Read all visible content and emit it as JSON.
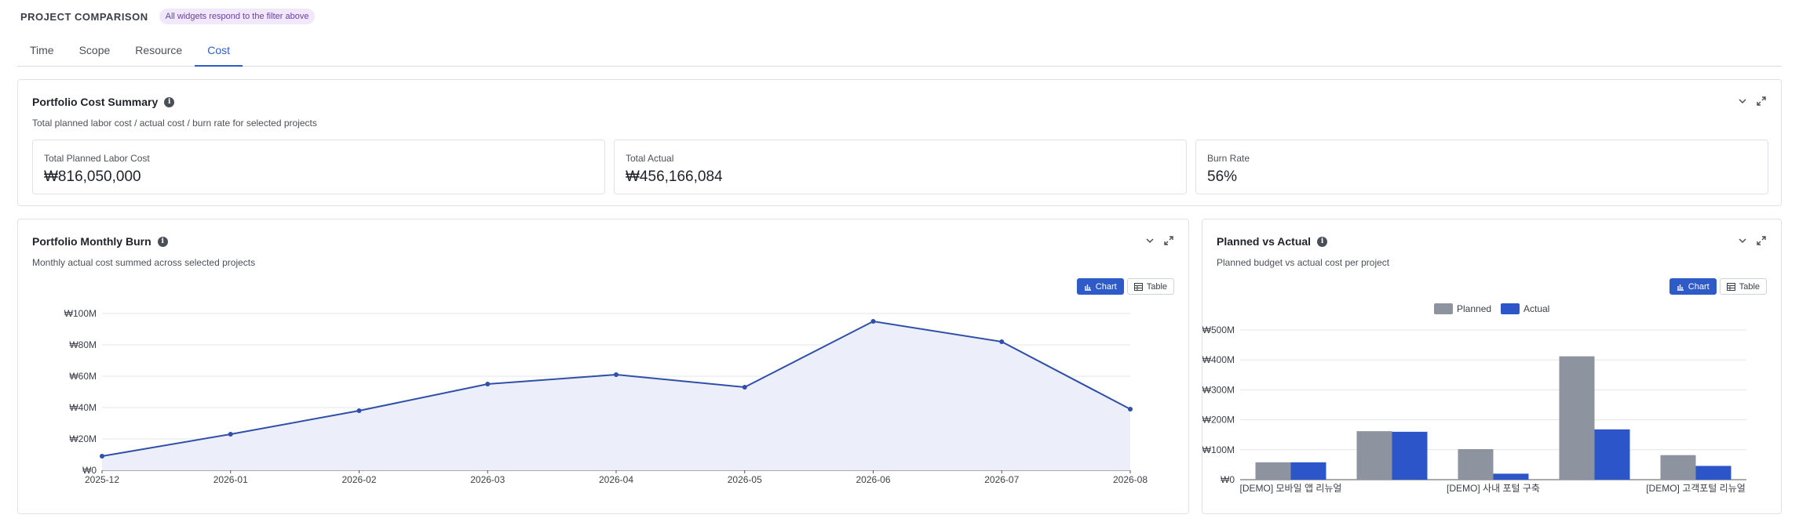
{
  "header": {
    "title": "PROJECT COMPARISON",
    "badge": "All widgets respond to the filter above"
  },
  "tabs": [
    {
      "label": "Time",
      "active": false
    },
    {
      "label": "Scope",
      "active": false
    },
    {
      "label": "Resource",
      "active": false
    },
    {
      "label": "Cost",
      "active": true
    }
  ],
  "summary": {
    "title": "Portfolio Cost Summary",
    "subtitle": "Total planned labor cost / actual cost / burn rate for selected projects",
    "kpis": [
      {
        "label": "Total Planned Labor Cost",
        "value": "₩816,050,000"
      },
      {
        "label": "Total Actual",
        "value": "₩456,166,084"
      },
      {
        "label": "Burn Rate",
        "value": "56%"
      }
    ]
  },
  "burn": {
    "title": "Portfolio Monthly Burn",
    "subtitle": "Monthly actual cost summed across selected projects",
    "chart_label": "Chart",
    "table_label": "Table"
  },
  "pva": {
    "title": "Planned vs Actual",
    "subtitle": "Planned budget vs actual cost per project",
    "chart_label": "Chart",
    "table_label": "Table"
  },
  "icons": {
    "info": "info-icon",
    "collapse": "chevron-down-icon",
    "expand": "expand-icon",
    "chart": "bar-chart-icon",
    "table": "table-icon"
  },
  "colors": {
    "accent": "#2f5bc9",
    "line": "#2f4fa8",
    "area": "#eceff9",
    "planned": "#8e949f",
    "actual": "#2c55c9",
    "badge_bg": "#f1e8fb",
    "badge_text": "#6b3fa0"
  },
  "chart_data": [
    {
      "type": "area",
      "x": [
        "2025-12",
        "2026-01",
        "2026-02",
        "2026-03",
        "2026-04",
        "2026-05",
        "2026-06",
        "2026-07",
        "2026-08"
      ],
      "series": [
        {
          "values": [
            9,
            23,
            38,
            55,
            61,
            53,
            95,
            82,
            39
          ]
        }
      ],
      "y_unit": "M KRW",
      "y_ticks": [
        "₩0",
        "₩20M",
        "₩40M",
        "₩60M",
        "₩80M",
        "₩100M"
      ],
      "ylim": [
        0,
        100
      ],
      "grid": true
    },
    {
      "type": "bar",
      "categories": [
        "[DEMO] 모바일 앱 리뉴얼",
        "",
        "[DEMO] 사내 포털 구축",
        "",
        "[DEMO] 고객포털 리뉴얼"
      ],
      "series": [
        {
          "name": "Planned",
          "values": [
            58,
            162,
            102,
            412,
            82
          ]
        },
        {
          "name": "Actual",
          "values": [
            58,
            160,
            20,
            168,
            46
          ]
        }
      ],
      "y_unit": "M KRW",
      "y_ticks": [
        "₩0",
        "₩100M",
        "₩200M",
        "₩300M",
        "₩400M",
        "₩500M"
      ],
      "ylim": [
        0,
        500
      ],
      "legend": "top",
      "grid": true
    }
  ]
}
